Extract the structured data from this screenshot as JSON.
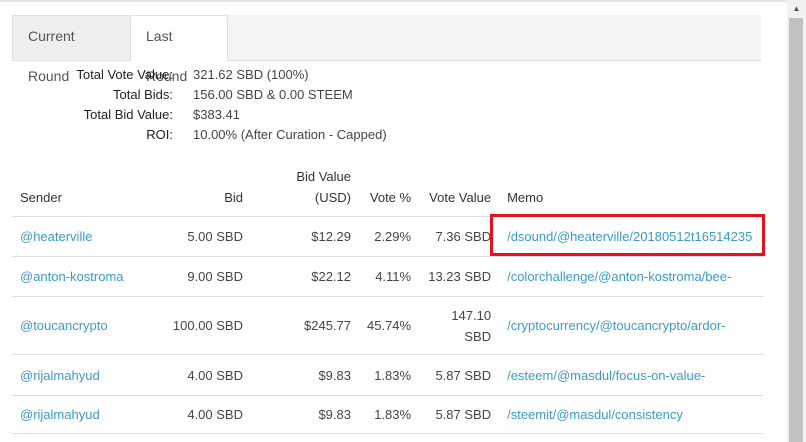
{
  "tabs": [
    {
      "label": "Current Round",
      "active": false
    },
    {
      "label": "Last Round",
      "active": true
    }
  ],
  "summary": [
    {
      "label": "Total Vote Value:",
      "value": "321.62 SBD (100%)"
    },
    {
      "label": "Total Bids:",
      "value": "156.00 SBD & 0.00 STEEM"
    },
    {
      "label": "Total Bid Value:",
      "value": "$383.41"
    },
    {
      "label": "ROI:",
      "value": "10.00% (After Curation - Capped)"
    }
  ],
  "table": {
    "headers": {
      "sender": "Sender",
      "bid": "Bid",
      "bid_value": "Bid Value (USD)",
      "vote_pct": "Vote %",
      "vote_value": "Vote Value",
      "memo": "Memo"
    },
    "rows": [
      {
        "sender": "@heaterville",
        "bid": "5.00 SBD",
        "bid_value": "$12.29",
        "vote_pct": "2.29%",
        "vote_value": "7.36 SBD",
        "memo": "/dsound/@heaterville/20180512t16514235"
      },
      {
        "sender": "@anton-kostroma",
        "bid": "9.00 SBD",
        "bid_value": "$22.12",
        "vote_pct": "4.11%",
        "vote_value": "13.23 SBD",
        "memo": "/colorchallenge/@anton-kostroma/bee-"
      },
      {
        "sender": "@toucancrypto",
        "bid": "100.00 SBD",
        "bid_value": "$245.77",
        "vote_pct": "45.74%",
        "vote_value": "147.10 SBD",
        "memo": "/cryptocurrency/@toucancrypto/ardor-"
      },
      {
        "sender": "@rijalmahyud",
        "bid": "4.00 SBD",
        "bid_value": "$9.83",
        "vote_pct": "1.83%",
        "vote_value": "5.87 SBD",
        "memo": "/esteem/@masdul/focus-on-value-"
      },
      {
        "sender": "@rijalmahyud",
        "bid": "4.00 SBD",
        "bid_value": "$9.83",
        "vote_pct": "1.83%",
        "vote_value": "5.87 SBD",
        "memo": "/steemit/@masdul/consistency"
      }
    ]
  },
  "colors": {
    "link": "#3a9bc7",
    "highlight": "#e0141e"
  }
}
